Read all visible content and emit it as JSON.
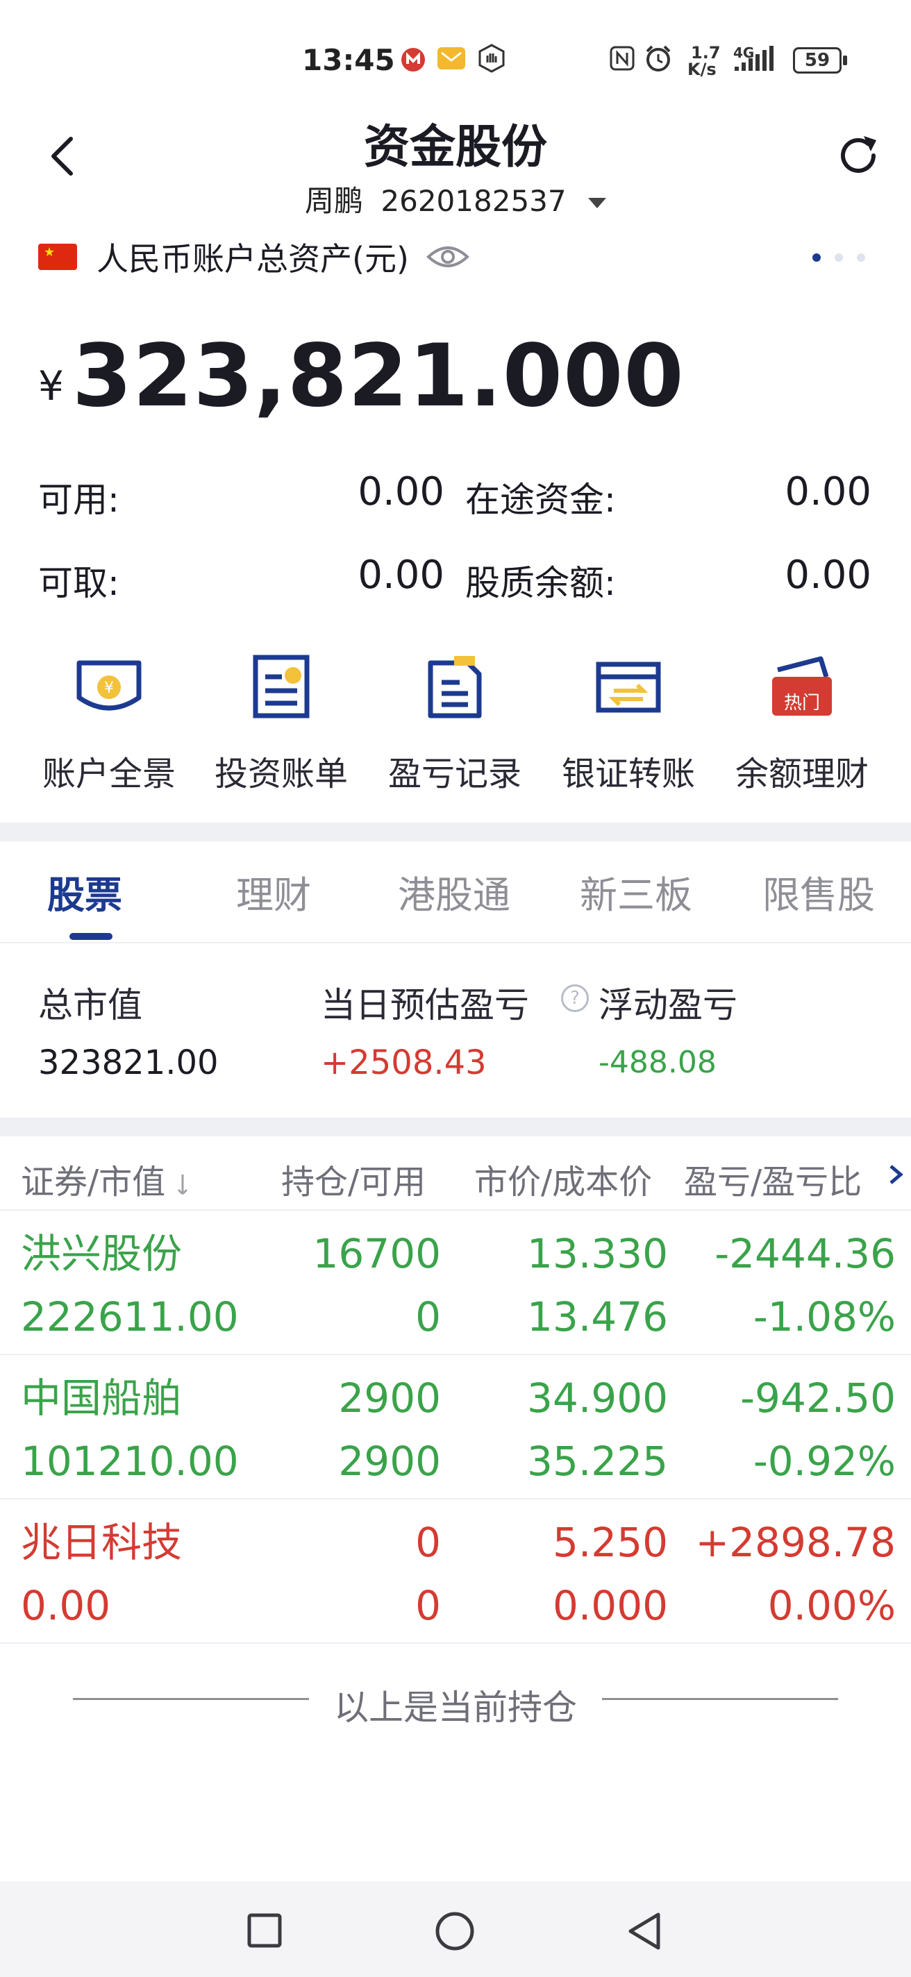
{
  "status_bar": {
    "time": "13:45",
    "network_speed_top": "1.7",
    "network_speed_bottom": "K/s",
    "network_type": "4G",
    "battery": "59"
  },
  "nav": {
    "title": "资金股份",
    "account_name": "周鹏",
    "account_number": "2620182537"
  },
  "account": {
    "label": "人民币账户总资产(元)",
    "currency_symbol": "¥",
    "total_assets": "323,821.000",
    "available_label": "可用:",
    "available_value": "0.00",
    "in_transit_label": "在途资金:",
    "in_transit_value": "0.00",
    "withdrawable_label": "可取:",
    "withdrawable_value": "0.00",
    "pledge_label": "股质余额:",
    "pledge_value": "0.00"
  },
  "shortcuts": [
    {
      "label": "账户全景",
      "icon": "account-overview-icon"
    },
    {
      "label": "投资账单",
      "icon": "investment-bill-icon"
    },
    {
      "label": "盈亏记录",
      "icon": "profit-record-icon"
    },
    {
      "label": "银证转账",
      "icon": "bank-transfer-icon"
    },
    {
      "label": "余额理财",
      "icon": "balance-wealth-icon",
      "badge": "热门"
    }
  ],
  "tabs": [
    {
      "label": "股票",
      "active": true
    },
    {
      "label": "理财",
      "active": false
    },
    {
      "label": "港股通",
      "active": false
    },
    {
      "label": "新三板",
      "active": false
    },
    {
      "label": "限售股",
      "active": false
    }
  ],
  "summary": {
    "market_value_label": "总市值",
    "market_value": "323821.00",
    "daily_pl_label": "当日预估盈亏",
    "daily_pl": "+2508.43",
    "floating_pl_label": "浮动盈亏",
    "floating_pl": "-488.08"
  },
  "table": {
    "headers": [
      "证券/市值",
      "持仓/可用",
      "市价/成本价",
      "盈亏/盈亏比"
    ],
    "rows": [
      {
        "name": "洪兴股份",
        "market_value": "222611.00",
        "position": "16700",
        "available": "0",
        "price": "13.330",
        "cost": "13.476",
        "pl": "-2444.36",
        "pl_ratio": "-1.08%",
        "color": "green"
      },
      {
        "name": "中国船舶",
        "market_value": "101210.00",
        "position": "2900",
        "available": "2900",
        "price": "34.900",
        "cost": "35.225",
        "pl": "-942.50",
        "pl_ratio": "-0.92%",
        "color": "green"
      },
      {
        "name": "兆日科技",
        "market_value": "0.00",
        "position": "0",
        "available": "0",
        "price": "5.250",
        "cost": "0.000",
        "pl": "+2898.78",
        "pl_ratio": "0.00%",
        "color": "red"
      }
    ],
    "footer": "以上是当前持仓"
  },
  "colors": {
    "brand": "#1c3a8f",
    "up": "#d43b32",
    "down": "#3aa34a"
  }
}
